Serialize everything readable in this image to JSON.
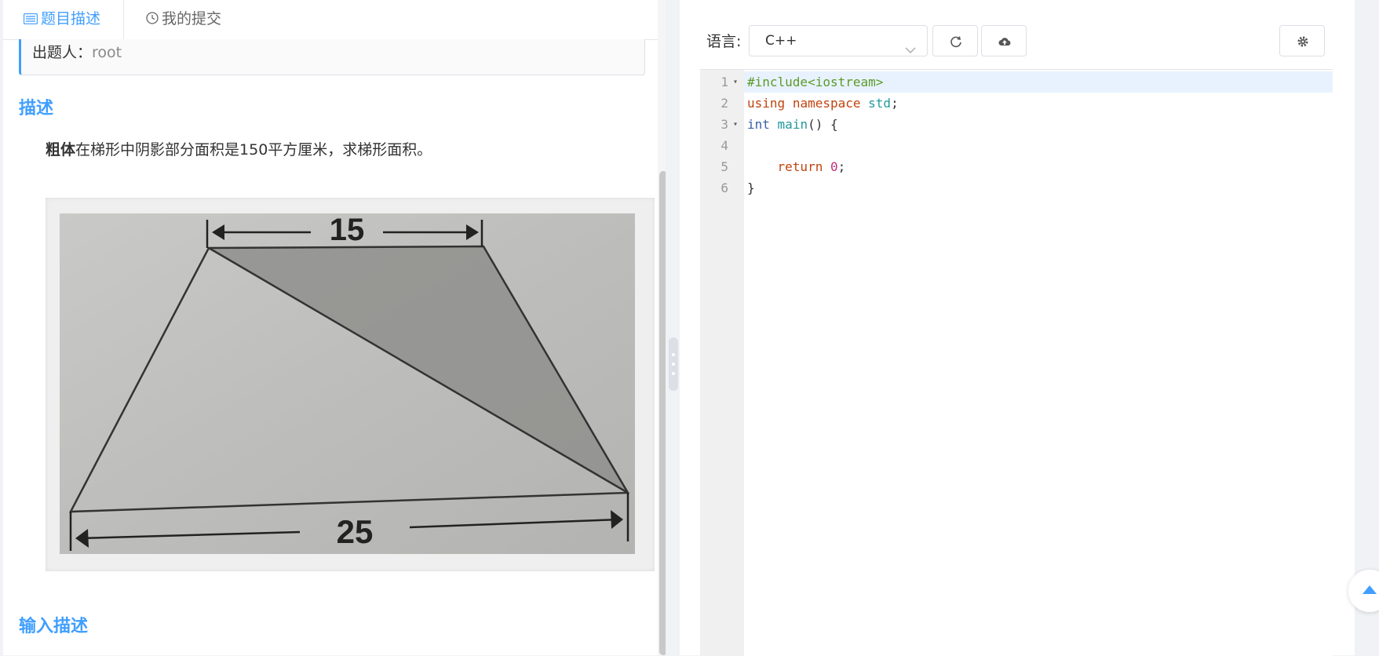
{
  "tabs": {
    "description": "题目描述",
    "submissions": "我的提交"
  },
  "problem": {
    "setter_label": "出题人：",
    "setter_name": "root",
    "description_title": "描述",
    "description_bold": "粗体",
    "description_text": "在梯形中阴影部分面积是150平方厘米，求梯形面积。",
    "input_title": "输入描述",
    "figure": {
      "top_length": "15",
      "bottom_length": "25"
    }
  },
  "editor": {
    "language_label": "语言:",
    "language_value": "C++",
    "lines": [
      {
        "no": "1",
        "fold": "▾"
      },
      {
        "no": "2",
        "fold": ""
      },
      {
        "no": "3",
        "fold": "▾"
      },
      {
        "no": "4",
        "fold": ""
      },
      {
        "no": "5",
        "fold": ""
      },
      {
        "no": "6",
        "fold": ""
      }
    ],
    "code": {
      "include": "#include<iostream>",
      "using": "using",
      "namespace": "namespace",
      "std": "std",
      "semicolon": ";",
      "int": "int",
      "main": "main",
      "main_rest": "() {",
      "return": "return",
      "zero": "0",
      "close": "}"
    }
  },
  "colors": {
    "accent": "#409eff"
  }
}
